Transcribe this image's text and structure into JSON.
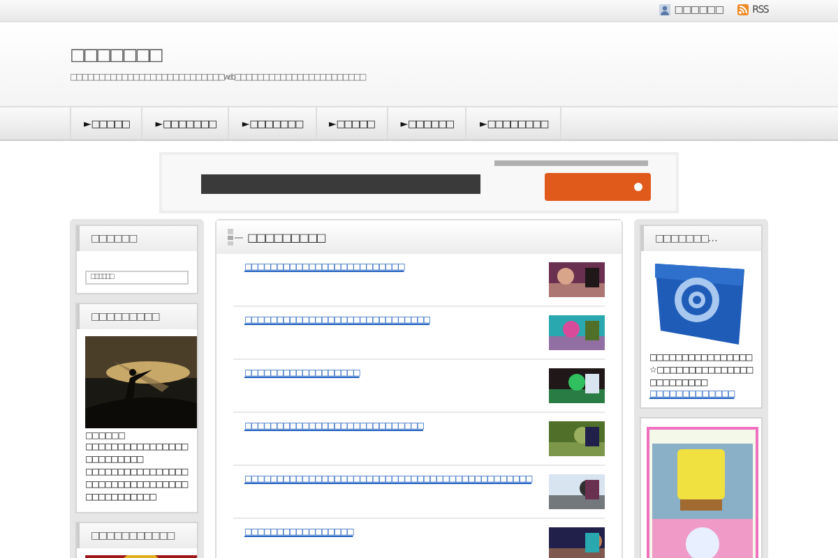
{
  "topbar": {
    "links": [
      {
        "kind": "user",
        "label": "□□□□□□"
      },
      {
        "kind": "rss",
        "label": "RSS"
      }
    ]
  },
  "header": {
    "title": "□□□□□□□",
    "tagline": "□□□□□□□□□□□□□□□□□□□□□□□□□□□web□□□□□□□□□□□□□□□□□□□□□□□"
  },
  "nav": [
    {
      "marker": "►",
      "label": "□□□□□"
    },
    {
      "marker": "►",
      "label": "□□□□□□□"
    },
    {
      "marker": "►",
      "label": "□□□□□□□"
    },
    {
      "marker": "►",
      "label": "□□□□□"
    },
    {
      "marker": "►",
      "label": "□□□□□□"
    },
    {
      "marker": "►",
      "label": "□□□□□□□□"
    }
  ],
  "left_sidebar": [
    {
      "kind": "search",
      "title": "□□□□□□",
      "placeholder": "□□□□□□"
    },
    {
      "kind": "profile",
      "title": "□□□□□□□□□",
      "name": "□□□□□□",
      "paragraphs": [
        "□□□□□□□□□□□□□□□□□□□□□□□□□",
        "□□□□□□□□□□□□□□□□□□□□□□□□□□□□□□□□□□□□□□□□□□□"
      ]
    },
    {
      "title": "□□□□□□□□□□□"
    }
  ],
  "main": {
    "title": "□□□□□□□□□",
    "posts": [
      {
        "title": "□□□□□□□□□□□□□□□□□□□□□□□□□"
      },
      {
        "title": "□□□□□□□□□□□□□□□□□□□□□□□□□□□□□"
      },
      {
        "title": "□□□□□□□□□□□□□□□□□□"
      },
      {
        "title": "□□□□□□□□□□□□□□□□□□□□□□□□□□□□"
      },
      {
        "title": "□□□□□□□□□□□□□□□□□□□□□□□□□□□□□□□□□□□□□□□□□□□□□"
      },
      {
        "title": "□□□□□□□□□□□□□□□□□"
      }
    ]
  },
  "right_sidebar": [
    {
      "kind": "about",
      "title": "□□□□□□□…",
      "text": "□□□□□□□□□□□□□□□□☆ □□□□□□□□□□□□□□□□□□□□□□□□",
      "link": "□□□□□□□□□□□□□"
    },
    {
      "kind": "ad"
    }
  ]
}
